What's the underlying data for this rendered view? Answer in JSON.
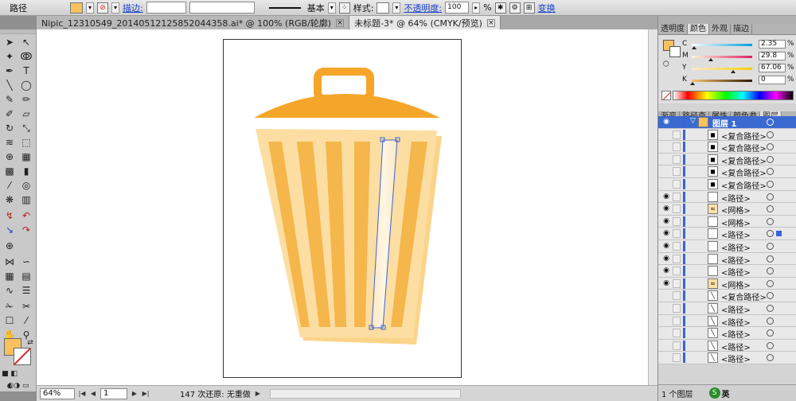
{
  "control_bar": {
    "object_type": "路径",
    "fill_color": "#f9c160",
    "stroke_label": "描边:",
    "stroke_profile": "基本",
    "style_label": "样式:",
    "opacity_label": "不透明度:",
    "opacity_value": "100",
    "percent": "%",
    "transform_link": "变换"
  },
  "doc_tabs": [
    {
      "label": "Nipic_12310549_20140512125852044358.ai* @ 100% (RGB/轮廓)",
      "active": false
    },
    {
      "label": "未标题-3* @ 64% (CMYK/预览)",
      "active": true
    }
  ],
  "color_panel": {
    "tabs": [
      "透明度",
      "颜色",
      "外观",
      "描边"
    ],
    "active_tab": "颜色",
    "channels": [
      {
        "label": "C",
        "value": "2.35",
        "unit": "%",
        "level": 0.0235,
        "from": "#ffffff",
        "to": "#00a0e0"
      },
      {
        "label": "M",
        "value": "29.8",
        "unit": "%",
        "level": 0.298,
        "from": "#fff6d8",
        "to": "#e0206a"
      },
      {
        "label": "Y",
        "value": "67.06",
        "unit": "%",
        "level": 0.6706,
        "from": "#fde8d0",
        "to": "#f7d000"
      },
      {
        "label": "K",
        "value": "0",
        "unit": "%",
        "level": 0,
        "from": "#fbc470",
        "to": "#2b1a00"
      }
    ]
  },
  "layers_panel": {
    "tabs": [
      "渐变",
      "路径查",
      "属性",
      "颜色参",
      "图层"
    ],
    "active_tab": "图层",
    "top_layer": "图层 1",
    "items": [
      {
        "label": "<复合路径>",
        "eye": false,
        "thumb": "dark"
      },
      {
        "label": "<复合路径>",
        "eye": false,
        "thumb": "dark"
      },
      {
        "label": "<复合路径>",
        "eye": false,
        "thumb": "dark"
      },
      {
        "label": "<复合路径>",
        "eye": false,
        "thumb": "dark"
      },
      {
        "label": "<复合路径>",
        "eye": false,
        "thumb": "dark"
      },
      {
        "label": "<路径>",
        "eye": true,
        "thumb": "light"
      },
      {
        "label": "<网格>",
        "eye": true,
        "thumb": "orange"
      },
      {
        "label": "<网格>",
        "eye": true,
        "thumb": "light"
      },
      {
        "label": "<路径>",
        "eye": true,
        "thumb": "light",
        "selected": true
      },
      {
        "label": "<路径>",
        "eye": true,
        "thumb": "light"
      },
      {
        "label": "<路径>",
        "eye": true,
        "thumb": "light"
      },
      {
        "label": "<路径>",
        "eye": true,
        "thumb": "light"
      },
      {
        "label": "<网格>",
        "eye": true,
        "thumb": "orange"
      },
      {
        "label": "<复合路径>",
        "eye": false,
        "thumb": "line"
      },
      {
        "label": "<路径>",
        "eye": false,
        "thumb": "line"
      },
      {
        "label": "<路径>",
        "eye": false,
        "thumb": "line"
      },
      {
        "label": "<路径>",
        "eye": false,
        "thumb": "line"
      },
      {
        "label": "<路径>",
        "eye": false,
        "thumb": "line"
      },
      {
        "label": "<路径>",
        "eye": false,
        "thumb": "line"
      }
    ],
    "footer_label": "1 个图层",
    "ime_label": "英"
  },
  "status_bar": {
    "zoom": "64%",
    "artboard": "1",
    "info": "147 次还原: 无重做"
  },
  "colors": {
    "bin_orange": "#f5a62a",
    "bin_light": "#fbd48a",
    "bin_stripe": "#f5b64b",
    "selection_blue": "#3b63d8"
  }
}
